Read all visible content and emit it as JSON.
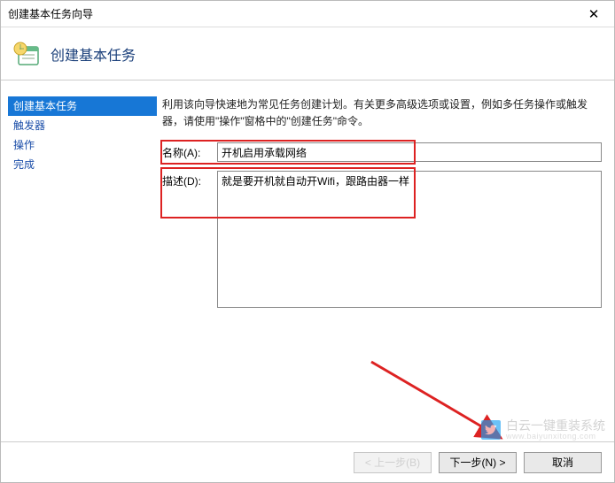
{
  "titlebar": {
    "title": "创建基本任务向导"
  },
  "header": {
    "title": "创建基本任务"
  },
  "sidebar": {
    "items": [
      {
        "label": "创建基本任务",
        "active": true
      },
      {
        "label": "触发器",
        "active": false
      },
      {
        "label": "操作",
        "active": false
      },
      {
        "label": "完成",
        "active": false
      }
    ]
  },
  "content": {
    "instructions": "利用该向导快速地为常见任务创建计划。有关更多高级选项或设置，例如多任务操作或触发器，请使用\"操作\"窗格中的\"创建任务\"命令。",
    "name_label": "名称(A):",
    "name_value": "开机启用承载网络",
    "desc_label": "描述(D):",
    "desc_value": "就是要开机就自动开Wifi，跟路由器一样"
  },
  "footer": {
    "back_label": "< 上一步(B)",
    "next_label": "下一步(N) >",
    "cancel_label": "取消"
  },
  "watermark": {
    "brand": "白云一键重装系统",
    "url": "www.baiyunxitong.com"
  }
}
